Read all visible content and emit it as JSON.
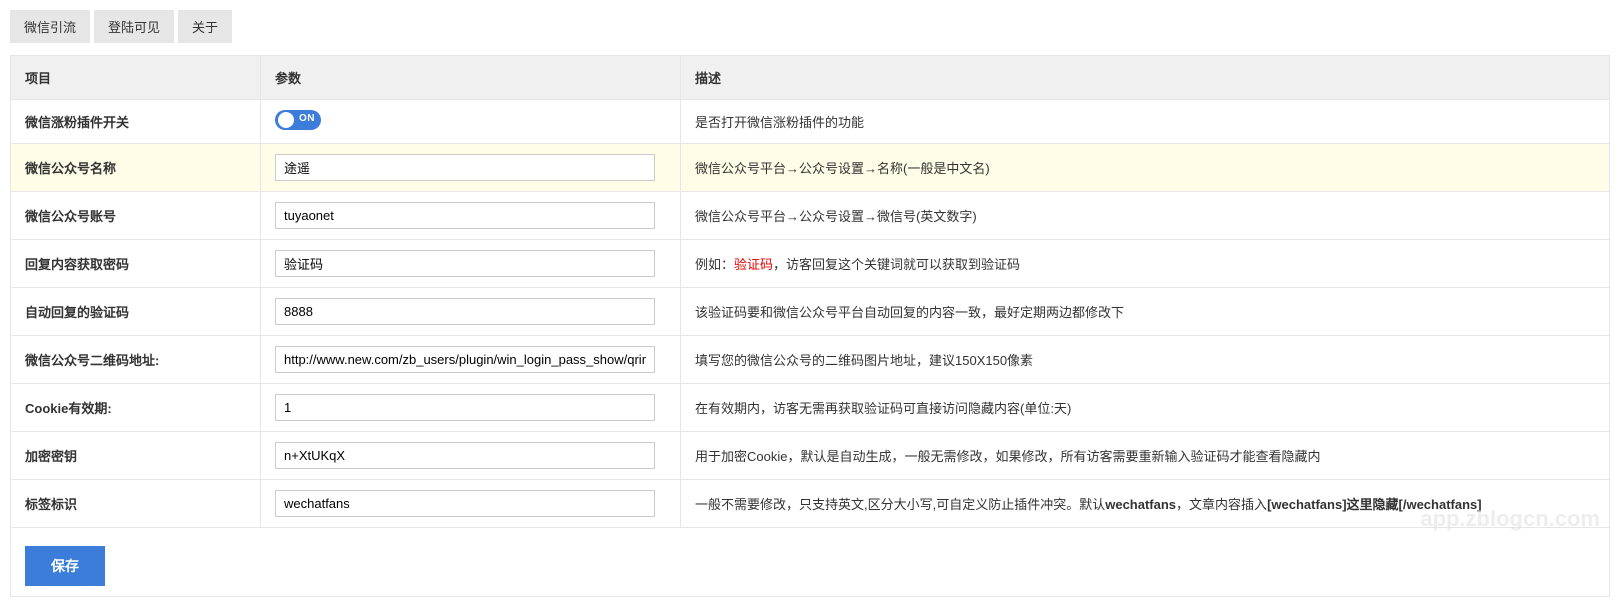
{
  "tabs": {
    "wechat": "微信引流",
    "login_visible": "登陆可见",
    "about": "关于"
  },
  "headers": {
    "item": "项目",
    "param": "参数",
    "desc": "描述"
  },
  "rows": {
    "switch": {
      "label": "微信涨粉插件开关",
      "toggle": "ON",
      "desc": "是否打开微信涨粉插件的功能"
    },
    "name": {
      "label": "微信公众号名称",
      "value": "途遥",
      "desc": "微信公众号平台→公众号设置→名称(一般是中文名)"
    },
    "account": {
      "label": "微信公众号账号",
      "value": "tuyaonet",
      "desc": "微信公众号平台→公众号设置→微信号(英文数字)"
    },
    "keyword": {
      "label": "回复内容获取密码",
      "value": "验证码",
      "desc_prefix": "例如：",
      "desc_red": "验证码",
      "desc_suffix": "，访客回复这个关键词就可以获取到验证码"
    },
    "code": {
      "label": "自动回复的验证码",
      "value": "8888",
      "desc": "该验证码要和微信公众号平台自动回复的内容一致，最好定期两边都修改下"
    },
    "qrcode": {
      "label": "微信公众号二维码地址:",
      "value": "http://www.new.com/zb_users/plugin/win_login_pass_show/qrim",
      "desc": "填写您的微信公众号的二维码图片地址，建议150X150像素"
    },
    "cookie": {
      "label": "Cookie有效期:",
      "value": "1",
      "desc": "在有效期内，访客无需再获取验证码可直接访问隐藏内容(单位:天)"
    },
    "secret": {
      "label": "加密密钥",
      "value": "n+XtUKqX",
      "desc": "用于加密Cookie，默认是自动生成，一般无需修改，如果修改，所有访客需要重新输入验证码才能查看隐藏内"
    },
    "tag": {
      "label": "标签标识",
      "value": "wechatfans",
      "desc_p1": "一般不需要修改，只支持英文,区分大小写,可自定义防止插件冲突。默认",
      "desc_b1": "wechatfans",
      "desc_p2": "，文章内容插入",
      "desc_b2": "[wechatfans]这里隐藏[/wechatfans]"
    }
  },
  "save": "保存",
  "watermark": "app.zblogcn.com"
}
